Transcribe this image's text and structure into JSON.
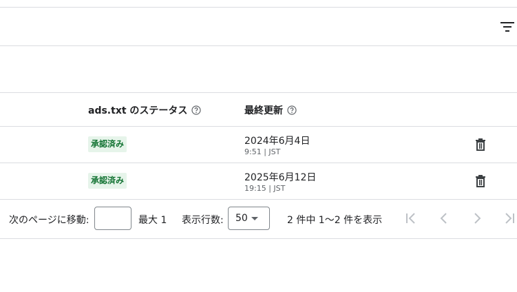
{
  "table": {
    "headers": {
      "status": "ads.txt のステータス",
      "updated": "最終更新"
    },
    "rows": [
      {
        "status": "承認済み",
        "date": "2024年6月4日",
        "time": "9:51 | JST"
      },
      {
        "status": "承認済み",
        "date": "2025年6月12日",
        "time": "19:15 | JST"
      }
    ]
  },
  "pager": {
    "goto_label": "次のページに移動:",
    "page_value": "",
    "max_label": "最大 1",
    "rows_label": "表示行数:",
    "rows_value": "50",
    "range_label": "2 件中 1〜2 件を表示"
  },
  "icons": {
    "filter": "filter-list-icon",
    "help": "help-outline-icon",
    "delete": "trash-icon",
    "first": "first-page-icon",
    "prev": "chevron-left-icon",
    "next": "chevron-right-icon",
    "last": "last-page-icon"
  },
  "colors": {
    "badge_bg": "#e6f4ea",
    "badge_text": "#137333",
    "divider": "#dadce0"
  }
}
